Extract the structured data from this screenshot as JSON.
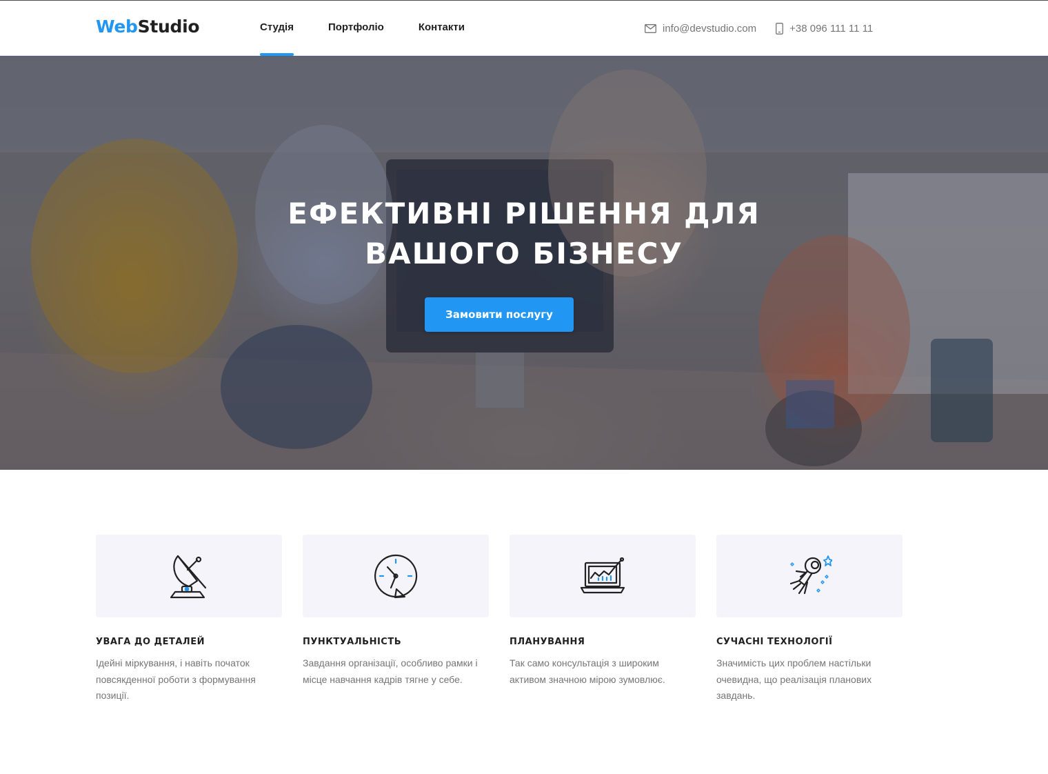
{
  "header": {
    "logo_part1": "Web",
    "logo_part2": "Studio",
    "nav": [
      {
        "label": "Студія",
        "active": true
      },
      {
        "label": "Портфоліо",
        "active": false
      },
      {
        "label": "Контакти",
        "active": false
      }
    ],
    "email": "info@devstudio.com",
    "phone": "+38 096 111 11 11"
  },
  "hero": {
    "title": "Ефективні рішення для вашого бізнесу",
    "cta_label": "Замовити послугу"
  },
  "features": [
    {
      "icon": "satellite-dish-icon",
      "title": "Увага до деталей",
      "text": "Ідейні міркування, і навіть початок повсякденної роботи з формування позиції."
    },
    {
      "icon": "clock-icon",
      "title": "Пунктуальність",
      "text": "Завдання організації, особливо рамки і місце навчання кадрів тягне у себе."
    },
    {
      "icon": "laptop-chart-icon",
      "title": "Планування",
      "text": "Так само консультація з широким активом значною мірою зумовлює."
    },
    {
      "icon": "astronaut-icon",
      "title": "Сучасні технології",
      "text": "Значимість цих проблем настільки очевидна, що реалізація планових завдань."
    }
  ],
  "colors": {
    "accent": "#2196f3",
    "text_dark": "#212121",
    "text_muted": "#757575",
    "card_bg": "#f5f4fa"
  }
}
